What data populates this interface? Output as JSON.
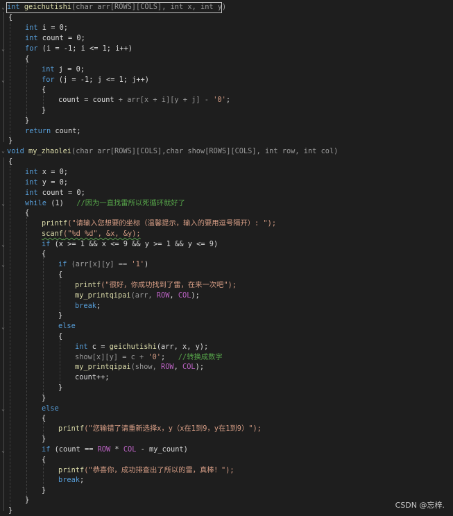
{
  "editor": {
    "theme": "dark",
    "background": "#1e1e1e",
    "colors": {
      "keyword": "#569cd6",
      "function": "#dcdcaa",
      "string": "#d69d85",
      "comment": "#57a64a",
      "macro": "#bd63c5",
      "default": "#dcdcdc"
    }
  },
  "code": {
    "l1_type": "int",
    "l1_name": "geichutishi",
    "l1_args": "(char arr[ROWS][COLS], int x, int y)",
    "l3_type": "int",
    "l3_rest": " i = 0;",
    "l4_type": "int",
    "l4_rest": " count = 0;",
    "l5_kw": "for",
    "l5_rest": " (i = -1; i <= 1; i++)",
    "l7_type": "int",
    "l7_rest": " j = 0;",
    "l8_kw": "for",
    "l8_rest": " (j = -1; j <= 1; j++)",
    "l10_a": "count",
    "l10_b": " = ",
    "l10_c": "count",
    "l10_d": " + arr[x + i][y + j] - ",
    "l10_e": "'0'",
    "l10_f": ";",
    "l13_kw": "return",
    "l13_rest": " count;",
    "l15_type": "void",
    "l15_name": "my_zhaolei",
    "l15_args": "(char arr[ROWS][COLS],char show[ROWS][COLS], int row, int col)",
    "l17_type": "int",
    "l17_rest": " x = 0;",
    "l18_type": "int",
    "l18_rest": " y = 0;",
    "l19_type": "int",
    "l19_rest": " count = 0;",
    "l20_kw": "while",
    "l20_rest": " (1)   ",
    "l20_cm": "//因为一直找雷所以死循环就好了",
    "l22_fn": "printf",
    "l22_str": "(\"请输入您想要的坐标（温馨提示，输入的要用逗号隔开）: \");",
    "l23_fn": "scanf",
    "l23_str": "(\"%d %d\", &x, &y);",
    "l24_kw": "if",
    "l24_rest": " (x >= 1 && x <= 9 && y >= 1 && y <= 9)",
    "l26_kw": "if",
    "l26_rest": " (arr[x][y] == ",
    "l26_str": "'1'",
    "l26_end": ")",
    "l28_fn": "printf",
    "l28_str": "(\"很好，你成功找到了雷，在来一次吧\");",
    "l29_fn": "my_printqipai",
    "l29_a": "(arr, ",
    "l29_m1": "ROW",
    "l29_b": ", ",
    "l29_m2": "COL",
    "l29_c": ");",
    "l30_kw": "break",
    "l30_rest": ";",
    "l32_kw": "else",
    "l34_type": "int",
    "l34_rest": " c = ",
    "l34_fn": "geichutishi",
    "l34_args": "(arr, x, y);",
    "l35_a": "show[x][y] = c + ",
    "l35_str": "'0'",
    "l35_b": ";   ",
    "l35_cm": "//转换成数字",
    "l36_fn": "my_printqipai",
    "l36_a": "(show, ",
    "l36_m1": "ROW",
    "l36_b": ", ",
    "l36_m2": "COL",
    "l36_c": ");",
    "l37_a": "count++;",
    "l40_kw": "else",
    "l42_fn": "printf",
    "l42_str": "(\"您输错了请重新选择x，y（x在1到9，y在1到9）\");",
    "l44_kw": "if",
    "l44_a": " (count == ",
    "l44_m1": "ROW",
    "l44_b": " * ",
    "l44_m2": "COL",
    "l44_c": " - my_count)",
    "l46_fn": "printf",
    "l46_str": "(\"恭喜你，成功排查出了所以的雷，真棒！\");",
    "l47_kw": "break",
    "l47_rest": ";"
  },
  "braces": {
    "open": "{",
    "close": "}"
  },
  "watermark": "CSDN @忘梓."
}
